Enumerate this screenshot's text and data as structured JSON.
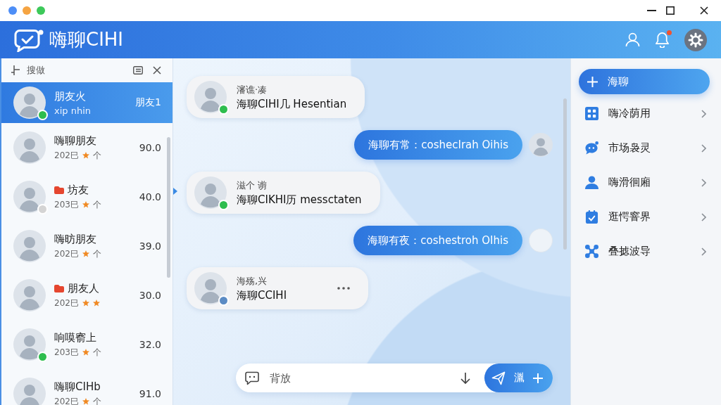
{
  "header": {
    "app_name": "嗨聊CIHI",
    "unread_notifications": true
  },
  "sidebar": {
    "search_label": "搜做",
    "contacts": [
      {
        "name": "朋友火",
        "subtitle": "xip nhin",
        "value": "朋友1",
        "selected": true,
        "flagged": false,
        "color": "#2ebd4e"
      },
      {
        "name": "嗨聊朋友",
        "meta": [
          {
            "kind": "text",
            "text": "202巳"
          },
          {
            "kind": "star"
          },
          {
            "kind": "text",
            "text": "个"
          }
        ],
        "value": "90.0",
        "selected": false,
        "flagged": false
      },
      {
        "name": "坊友",
        "meta": [
          {
            "kind": "text",
            "text": "203巳"
          },
          {
            "kind": "star"
          },
          {
            "kind": "text",
            "text": "个"
          }
        ],
        "value": "40.0",
        "selected": false,
        "flagged": true,
        "color": "#d4d4d4"
      },
      {
        "name": "嗨昉朋友",
        "meta": [
          {
            "kind": "text",
            "text": "202巳"
          },
          {
            "kind": "star"
          },
          {
            "kind": "text",
            "text": "个"
          }
        ],
        "value": "39.0",
        "selected": false,
        "flagged": false
      },
      {
        "name": "朋友人",
        "meta": [
          {
            "kind": "text",
            "text": "202巳"
          },
          {
            "kind": "star"
          },
          {
            "kind": "star"
          }
        ],
        "value": "30.0",
        "selected": false,
        "flagged": true
      },
      {
        "name": "响嗼窬上",
        "meta": [
          {
            "kind": "text",
            "text": "203巳"
          },
          {
            "kind": "star"
          },
          {
            "kind": "text",
            "text": "个"
          }
        ],
        "value": "32.0",
        "selected": false,
        "flagged": false,
        "color": "#2ebd4e"
      },
      {
        "name": "嗨聊CIHb",
        "meta": [
          {
            "kind": "text",
            "text": "202巳"
          },
          {
            "kind": "star"
          },
          {
            "kind": "text",
            "text": "个"
          }
        ],
        "value": "91.0",
        "selected": false,
        "flagged": false
      }
    ]
  },
  "chat": {
    "messages": [
      {
        "kind": "incoming",
        "sender": "瀋谯·凑",
        "text": "海聊CIHI几 Hesentian",
        "color": "#2ebd4e",
        "more": false
      },
      {
        "kind": "outgoing",
        "text": "海聊有常：coshecIrah Oihis",
        "avatar_loaded": true
      },
      {
        "kind": "incoming",
        "sender": "滋个 谫",
        "text": "海聊CIKHI历 messctaten",
        "color": "#2ebd4e",
        "more": false
      },
      {
        "kind": "outgoing",
        "text": "海聊有夜：coshestroh OIhis",
        "avatar_loaded": false
      },
      {
        "kind": "incoming",
        "sender": "海殇,兴",
        "text": "海聊CCIHI",
        "color": "#5b8bc4",
        "more": true
      }
    ],
    "input": {
      "placeholder": "背放",
      "send_label": "湚"
    }
  },
  "panel": {
    "new_chat_label": "海聊",
    "items": [
      {
        "kind": "apps",
        "label": "嗨冷荫用"
      },
      {
        "kind": "chat",
        "label": "市场袅灵"
      },
      {
        "kind": "person",
        "label": "嗨滑徊廂"
      },
      {
        "kind": "calendar",
        "label": "逛愕窨界"
      },
      {
        "kind": "network",
        "label": "叠摅波导"
      }
    ]
  }
}
